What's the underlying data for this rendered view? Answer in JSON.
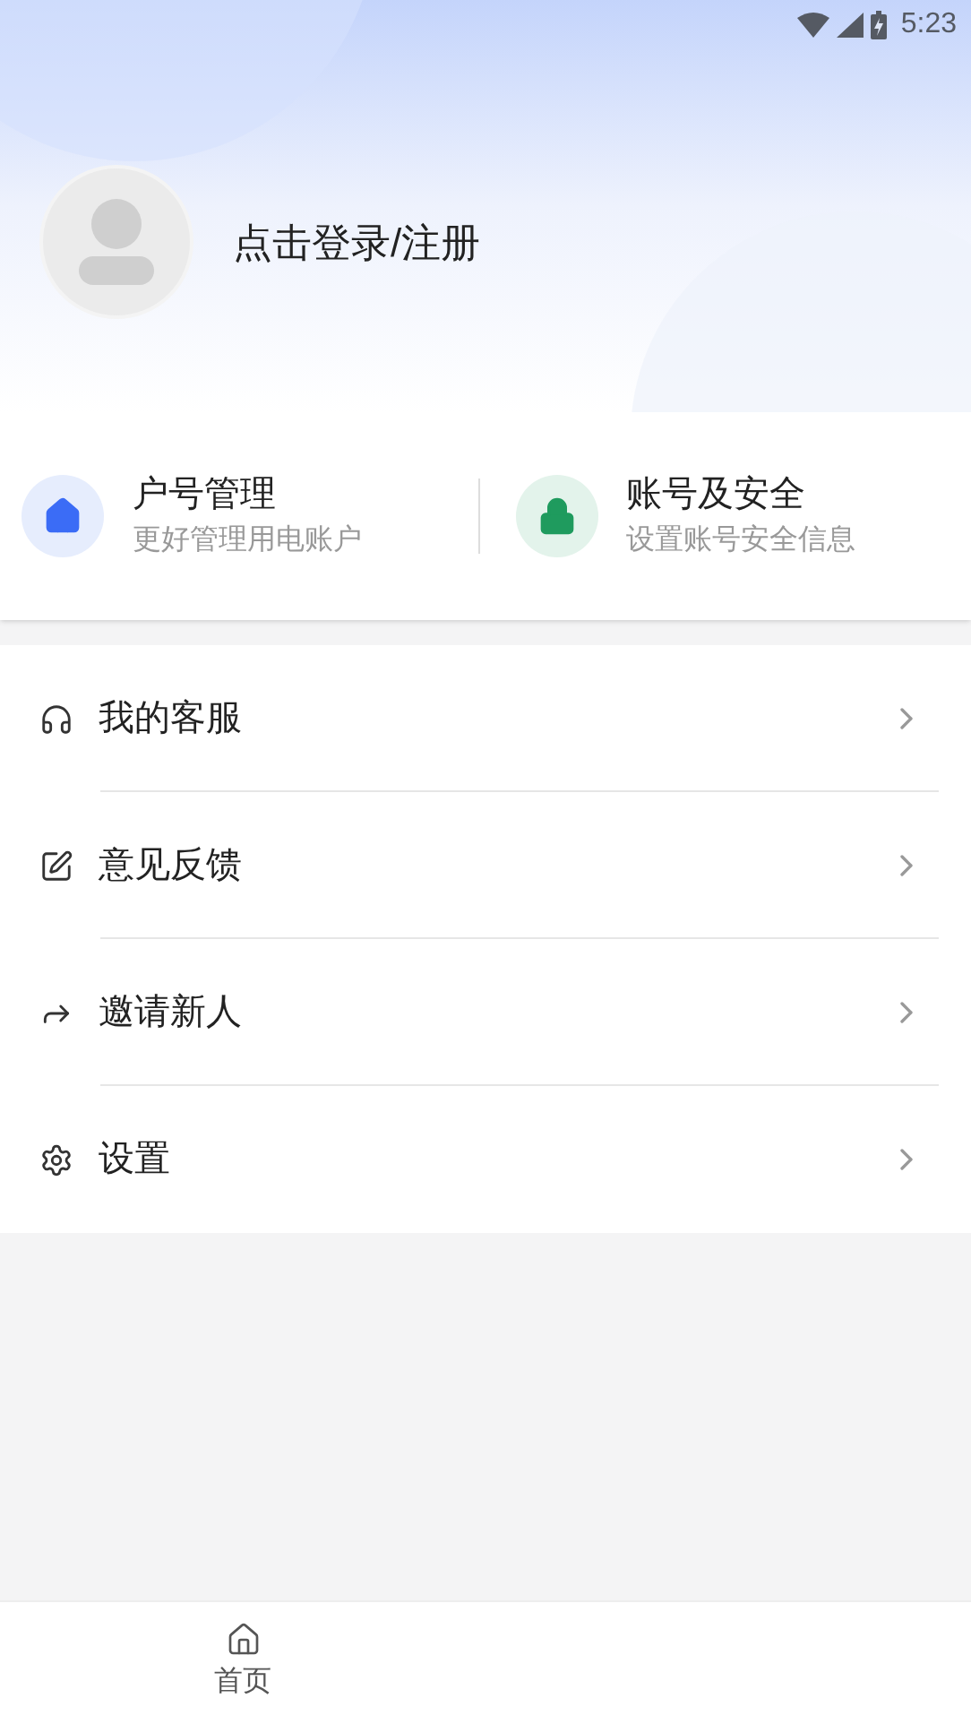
{
  "status_bar": {
    "time": "5:23"
  },
  "profile": {
    "login_text": "点击登录/注册"
  },
  "quick_cards": [
    {
      "title": "户号管理",
      "subtitle": "更好管理用电账户"
    },
    {
      "title": "账号及安全",
      "subtitle": "设置账号安全信息"
    }
  ],
  "menu": [
    {
      "label": "我的客服"
    },
    {
      "label": "意见反馈"
    },
    {
      "label": "邀请新人"
    },
    {
      "label": "设置"
    }
  ],
  "bottom_nav": [
    {
      "label": "首页"
    }
  ]
}
